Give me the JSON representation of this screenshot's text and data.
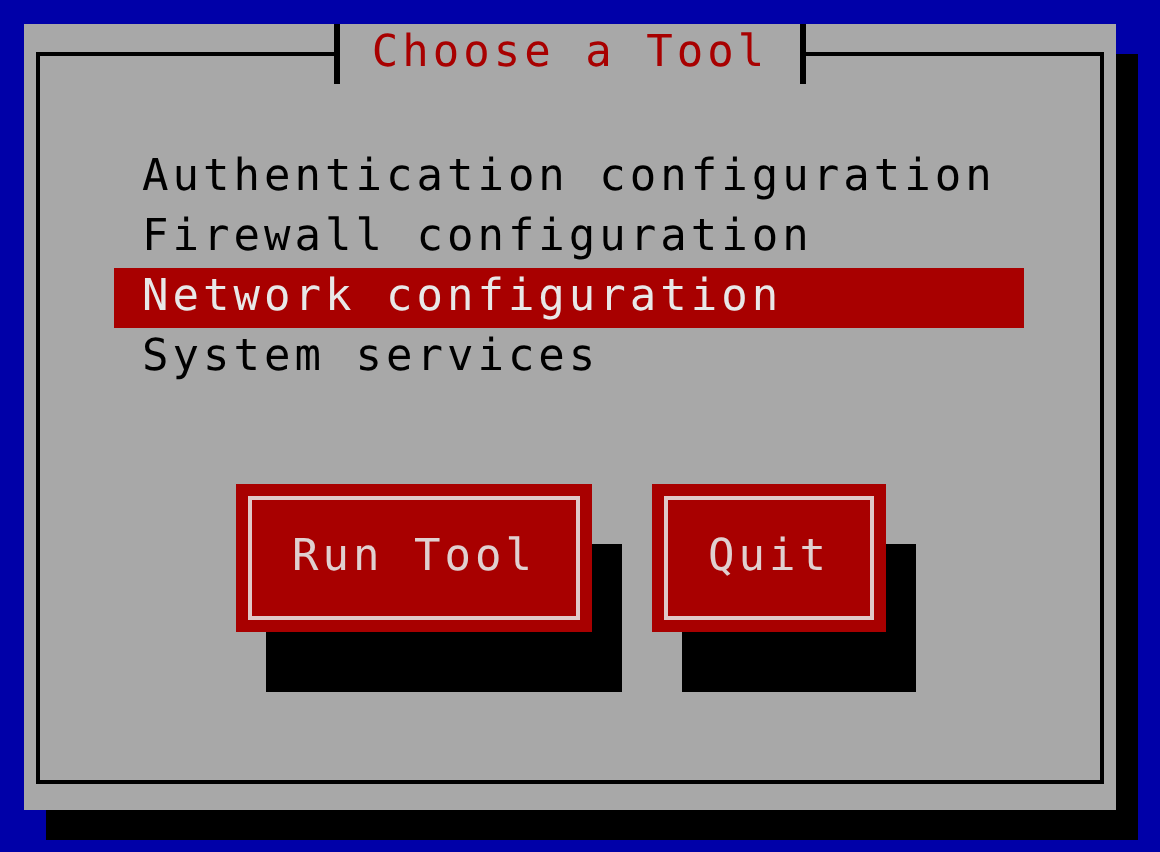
{
  "dialog": {
    "title": "Choose a Tool"
  },
  "tools": [
    {
      "label": "Authentication configuration",
      "selected": false
    },
    {
      "label": "Firewall configuration",
      "selected": false
    },
    {
      "label": "Network configuration",
      "selected": true
    },
    {
      "label": "System services",
      "selected": false
    }
  ],
  "buttons": [
    "Run Tool",
    "Quit"
  ]
}
